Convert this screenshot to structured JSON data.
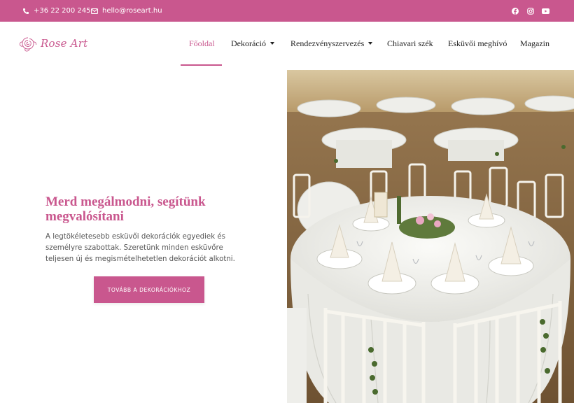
{
  "topbar": {
    "phone": "+36 22 200 245",
    "email": "hello@roseart.hu",
    "phone_icon": "phone-icon",
    "email_icon": "envelope-icon",
    "socials": [
      "facebook-icon",
      "instagram-icon",
      "youtube-icon"
    ]
  },
  "brand": {
    "logo_text": "Rose Art",
    "logo_icon": "rose-logo-icon"
  },
  "nav": {
    "items": [
      {
        "label": "Főoldal",
        "active": true
      },
      {
        "label": "Dekoráció",
        "dropdown": true
      },
      {
        "label": "Rendezvényszervezés",
        "dropdown": true
      },
      {
        "label": "Chiavari szék"
      },
      {
        "label": "Esküvői meghívó"
      },
      {
        "label": "Magazin"
      }
    ]
  },
  "hero": {
    "title": "Merd megálmodni, segítünk megvalósítani",
    "text": "A legtökéletesebb esküvői dekorációk egyediek és személyre szabottak. Szeretünk minden esküvőre teljesen új és megismételhetetlen dekorációt alkotni.",
    "cta_label": "TOVÁBB A DEKORÁCIÓKHOZ"
  },
  "colors": {
    "accent": "#c9578e",
    "text": "#555555",
    "nav_text": "#222222"
  }
}
